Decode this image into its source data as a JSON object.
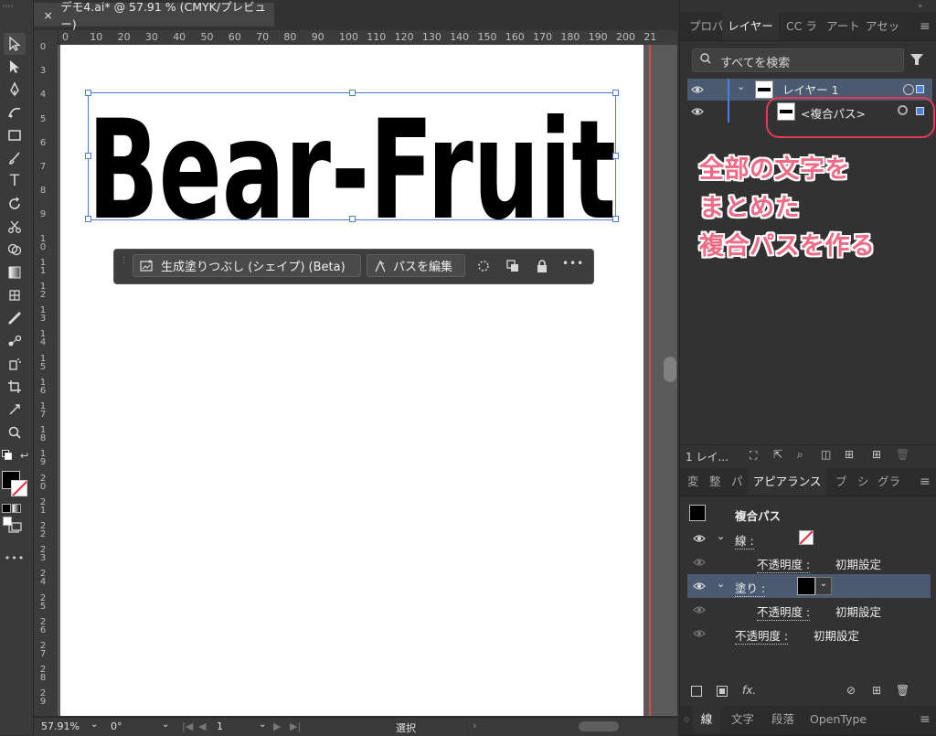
{
  "document": {
    "tab_title": "デモ4.ai* @ 57.91 % (CMYK/プレビュー)",
    "close_glyph": "×"
  },
  "ruler": {
    "h_ticks": [
      "0",
      "10",
      "20",
      "30",
      "40",
      "50",
      "60",
      "70",
      "80",
      "90",
      "100",
      "110",
      "120",
      "130",
      "140",
      "150",
      "160",
      "170",
      "180",
      "190",
      "200",
      "21"
    ],
    "v_ticks": [
      "0",
      "3",
      "4",
      "5",
      "6",
      "7",
      "8",
      "9",
      "10",
      "11",
      "12",
      "13",
      "14",
      "15",
      "16",
      "17",
      "18",
      "19",
      "20",
      "21",
      "22",
      "23",
      "24",
      "25",
      "26",
      "27",
      "28",
      "29"
    ]
  },
  "artwork": {
    "text": "Bear-Fruit"
  },
  "context_bar": {
    "generative_fill_label": "生成塗りつぶし (シェイプ) (Beta)",
    "edit_path_label": "パスを編集",
    "more_glyph": "•••"
  },
  "status_bar": {
    "zoom": "57.91%",
    "rotation": "0°",
    "artboard_number": "1",
    "tool": "選択"
  },
  "top_panel": {
    "tabs": [
      "プロパ",
      "レイヤー",
      "CC ラ",
      "アート",
      "アセッ"
    ],
    "active_tab": "レイヤー",
    "search_placeholder": "すべてを検索",
    "layers": [
      {
        "name": "レイヤー 1"
      },
      {
        "name": "<複合パス>"
      }
    ],
    "layer_count": "1 レイ..."
  },
  "annotation": {
    "lines": [
      "全部の文字を",
      "まとめた",
      "複合パスを作る"
    ]
  },
  "appearance_panel": {
    "tabs": [
      "変",
      "整",
      "パ",
      "アピアランス",
      "ブ",
      "シ",
      "グラ"
    ],
    "active_tab": "アピアランス",
    "object_type": "複合パス",
    "stroke_label": "線 :",
    "fill_label": "塗り :",
    "opacity_label": "不透明度 :",
    "opacity_value": "初期設定",
    "fx_label": "fx."
  },
  "bottom_tabs": [
    "線",
    "文字",
    "段落",
    "OpenType"
  ],
  "colors": {
    "selection_blue": "#4b7fd8",
    "annotation_pink": "#ee6a86",
    "annotation_ring": "#e03b58",
    "bleed_red": "#d84b4b"
  }
}
